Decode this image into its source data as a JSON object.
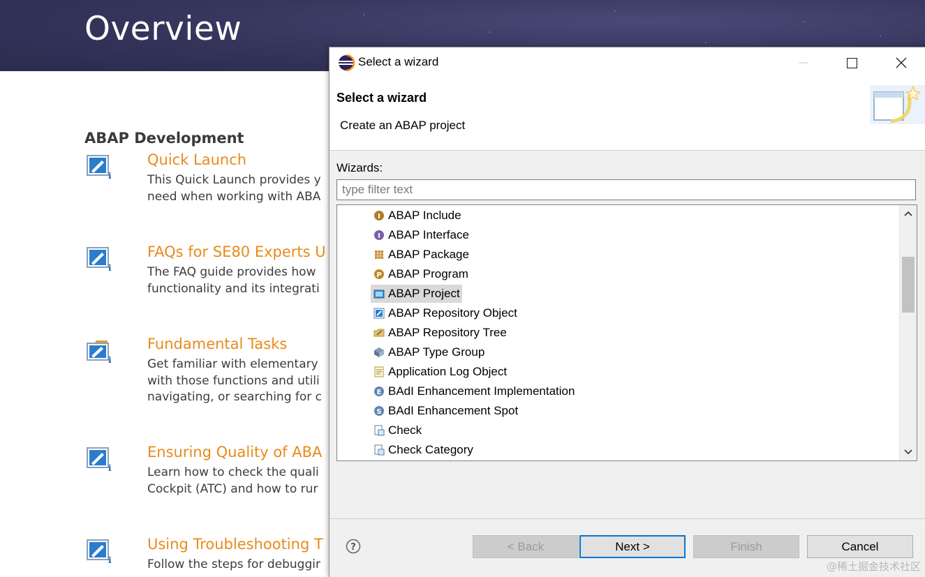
{
  "overview": {
    "title": "Overview",
    "section_title": "ABAP Development",
    "items": [
      {
        "title": "Quick Launch",
        "lines": [
          "This Quick Launch provides y",
          "need when working with ABA"
        ]
      },
      {
        "title": "FAQs for SE80 Experts U",
        "lines": [
          "The FAQ guide provides how",
          "functionality and its integrati"
        ]
      },
      {
        "title": "Fundamental Tasks",
        "lines": [
          "Get familiar with elementary",
          "with those functions and utili",
          "navigating, or searching for c"
        ]
      },
      {
        "title": "Ensuring Quality of ABA",
        "lines": [
          "Learn how to check the quali",
          "Cockpit (ATC) and how to rur"
        ]
      },
      {
        "title": "Using Troubleshooting T",
        "lines": [
          "Follow the steps for debuggir"
        ]
      }
    ]
  },
  "dialog": {
    "window_title": "Select a wizard",
    "header_title": "Select a wizard",
    "header_description": "Create an ABAP project",
    "wizards_label": "Wizards:",
    "filter_placeholder": "type filter text",
    "tree_items": [
      {
        "label": "ABAP Include",
        "icon": "abap-include-icon"
      },
      {
        "label": "ABAP Interface",
        "icon": "abap-interface-icon"
      },
      {
        "label": "ABAP Package",
        "icon": "abap-package-icon"
      },
      {
        "label": "ABAP Program",
        "icon": "abap-program-icon"
      },
      {
        "label": "ABAP Project",
        "icon": "abap-project-icon",
        "selected": true
      },
      {
        "label": "ABAP Repository Object",
        "icon": "abap-repository-object-icon"
      },
      {
        "label": "ABAP Repository Tree",
        "icon": "abap-repository-tree-icon"
      },
      {
        "label": "ABAP Type Group",
        "icon": "abap-type-group-icon"
      },
      {
        "label": "Application Log Object",
        "icon": "application-log-object-icon"
      },
      {
        "label": "BAdI Enhancement Implementation",
        "icon": "badi-implementation-icon"
      },
      {
        "label": "BAdI Enhancement Spot",
        "icon": "badi-spot-icon"
      },
      {
        "label": "Check",
        "icon": "check-icon"
      },
      {
        "label": "Check Category",
        "icon": "check-category-icon"
      }
    ],
    "buttons": {
      "back": "< Back",
      "next": "Next >",
      "finish": "Finish",
      "cancel": "Cancel"
    }
  },
  "watermark": "@稀土掘金技术社区"
}
